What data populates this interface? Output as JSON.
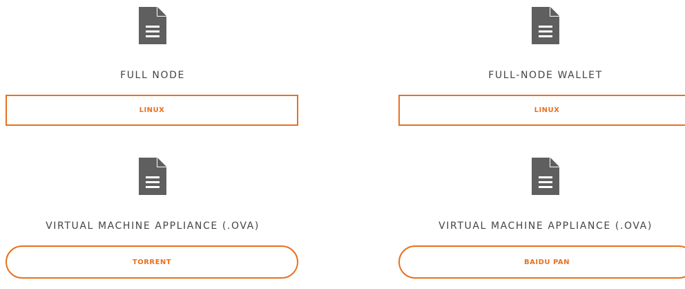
{
  "colors": {
    "accent": "#e8701e",
    "icon": "#5f5f5f",
    "title_text": "#444444"
  },
  "cards": [
    {
      "icon": "document-icon",
      "title": "FULL NODE",
      "button_label": "LINUX"
    },
    {
      "icon": "document-icon",
      "title": "FULL-NODE WALLET",
      "button_label": "LINUX"
    },
    {
      "icon": "document-icon",
      "title": "VIRTUAL MACHINE APPLIANCE (.OVA)",
      "button_label": "TORRENT"
    },
    {
      "icon": "document-icon",
      "title": "VIRTUAL MACHINE APPLIANCE (.OVA)",
      "button_label": "BAIDU PAN"
    }
  ]
}
